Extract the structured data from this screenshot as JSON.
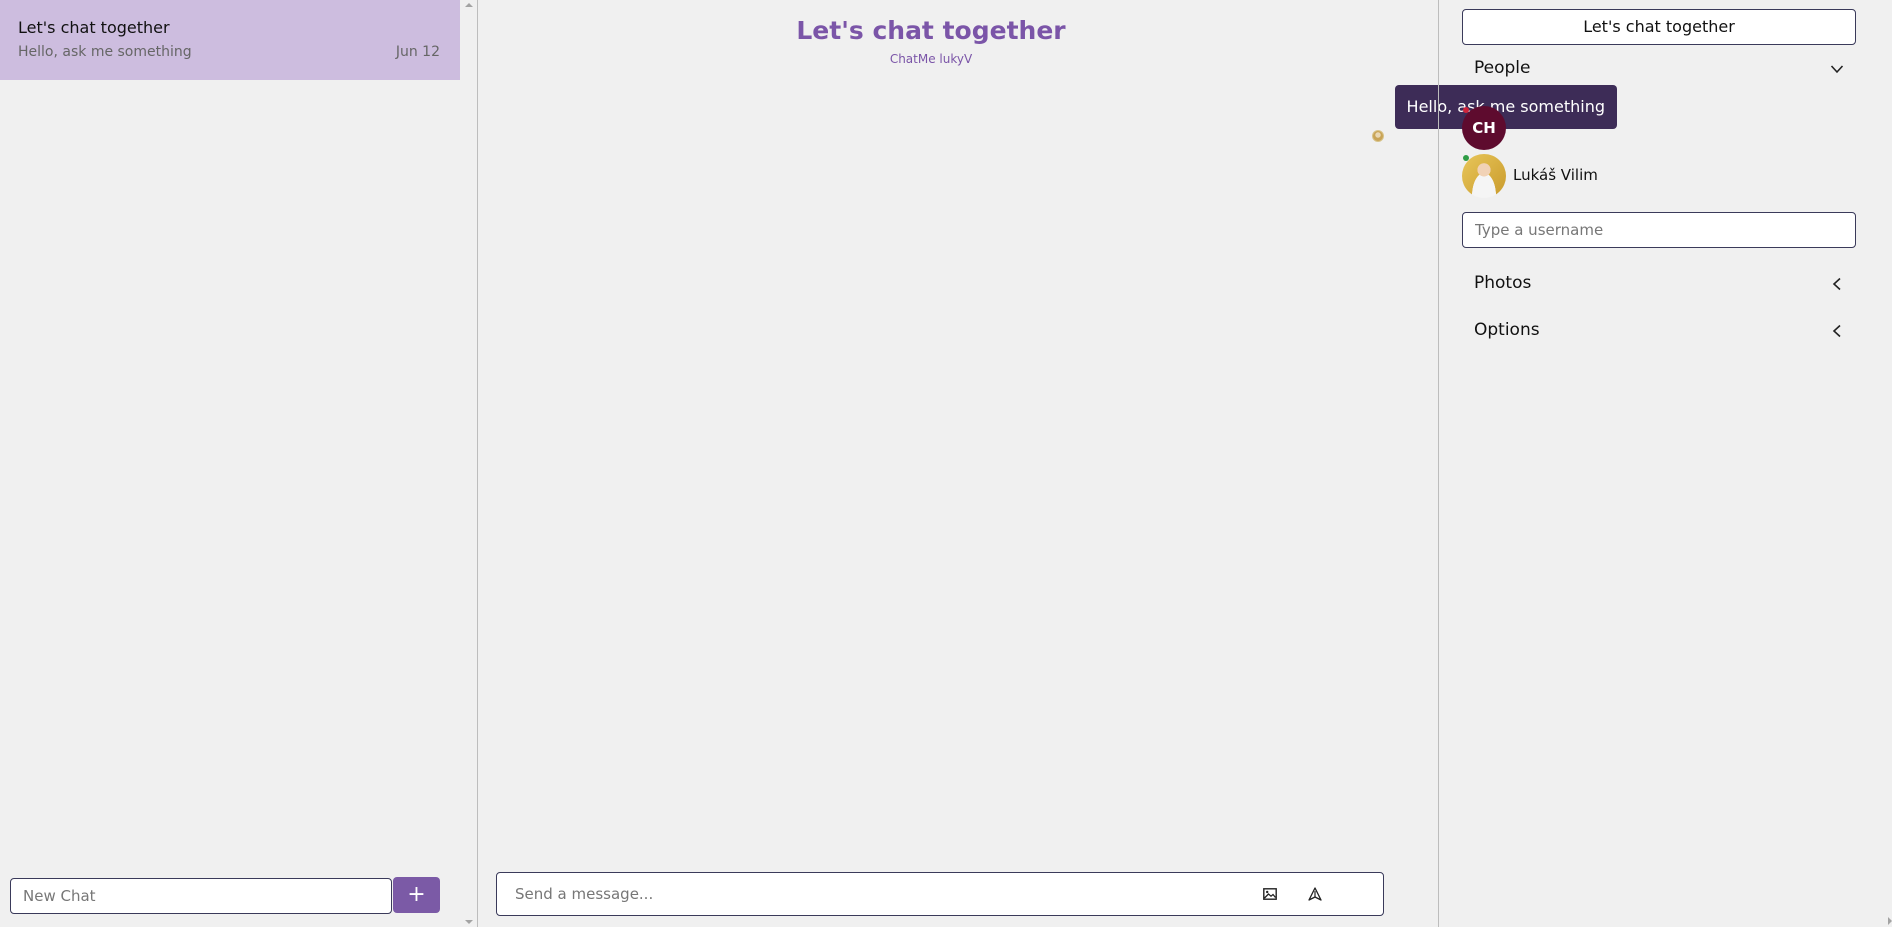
{
  "chat_list": {
    "chats": [
      {
        "title": "Let's chat together",
        "last_message": "Hello, ask me something",
        "date": "Jun 12"
      }
    ],
    "new_chat": {
      "placeholder": "New Chat",
      "button_label": "+"
    }
  },
  "chat_feed": {
    "title": "Let's chat together",
    "subtitle": "ChatMe lukyV",
    "messages": [
      {
        "text": "Hello, ask me something"
      }
    ],
    "message_form": {
      "placeholder": "Send a message..."
    },
    "icons": {
      "attach": "image-icon",
      "send": "send-icon"
    }
  },
  "settings": {
    "chat_title": "Let's chat together",
    "sections": {
      "people": {
        "label": "People",
        "chevron": "chevron-down-icon"
      },
      "photos": {
        "label": "Photos",
        "chevron": "chevron-left-icon"
      },
      "options": {
        "label": "Options",
        "chevron": "chevron-left-icon"
      }
    },
    "people": [
      {
        "initials": "CH",
        "name": "",
        "status": "offline"
      },
      {
        "initials": "",
        "name": "Lukáš Vilim",
        "status": "online"
      }
    ],
    "add_member": {
      "placeholder": "Type a username"
    }
  },
  "colors": {
    "accent": "#7b55a8",
    "selected_chat_bg": "#cdbddf",
    "bubble_bg": "#3d2c57",
    "avatar_bg": "#5e0b2e",
    "status_offline": "#d0243a",
    "status_online": "#2e9c45"
  }
}
